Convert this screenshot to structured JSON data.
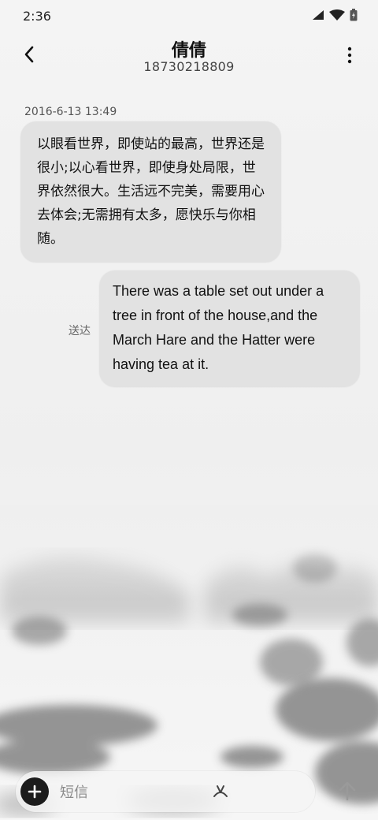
{
  "status_bar": {
    "time": "2:36"
  },
  "header": {
    "contact_name": "倩倩",
    "phone_number": "18730218809"
  },
  "conversation": {
    "timestamp": "2016-6-13 13:49",
    "messages": [
      {
        "direction": "incoming",
        "text": "以眼看世界，即使站的最高，世界还是很小;以心看世界，即使身处局限，世界依然很大。生活远不完美，需要用心去体会;无需拥有太多，愿快乐与你相随。"
      },
      {
        "direction": "outgoing",
        "text": "There was a table set out under a tree in front of the house,and the March Hare and the Hatter were having tea at it.",
        "status": "送达"
      }
    ]
  },
  "compose": {
    "placeholder": "短信"
  },
  "icons": {
    "back": "back-arrow-icon",
    "more": "more-vertical-icon",
    "add": "plus-icon",
    "emoji": "emoji-icon",
    "send": "send-arrow-icon"
  }
}
